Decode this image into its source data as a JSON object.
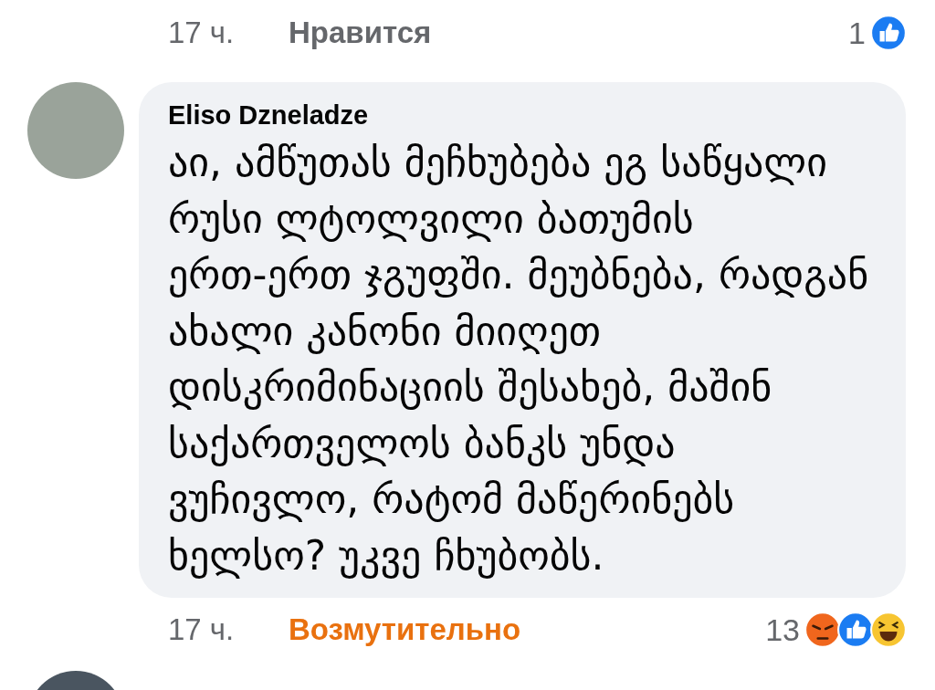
{
  "previous_comment_footer": {
    "time": "17 ч.",
    "reaction_button": {
      "label": "Нравится",
      "kind": "default"
    },
    "reaction_count": "1",
    "reaction_icons": [
      {
        "kind": "like"
      }
    ]
  },
  "comment": {
    "author": "Eliso Dzneladze",
    "text_lines": [
      "აი, ამწუთას მეჩხუბება ეგ საწყალი",
      "რუსი ლტოლვილი ბათუმის",
      "ერთ-ერთ ჯგუფში. მეუბნება, რადგან",
      "ახალი კანონი მიიღეთ",
      "დისკრიმინაციის შესახებ, მაშინ",
      "საქართველოს ბანკს უნდა",
      "ვუჩივლო, რატომ მაწერინებს",
      "ხელსო? უკვე ჩხუბობს."
    ],
    "footer": {
      "time": "17 ч.",
      "reaction_button": {
        "label": "Возмутительно",
        "kind": "angry"
      },
      "reaction_count": "13",
      "reaction_icons": [
        {
          "kind": "angry"
        },
        {
          "kind": "like"
        },
        {
          "kind": "haha"
        }
      ]
    }
  }
}
